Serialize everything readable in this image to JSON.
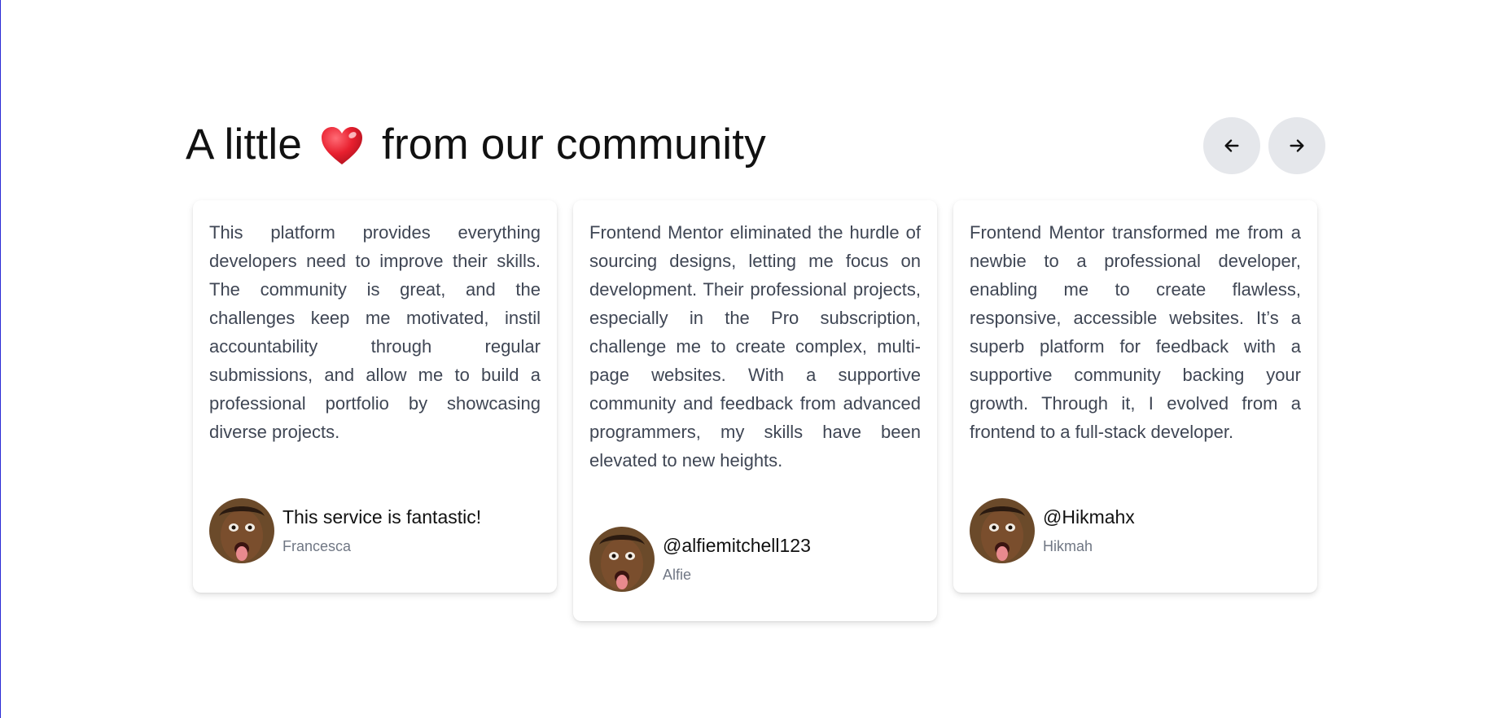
{
  "section": {
    "heading_before": "A little",
    "heading_after": "from our community",
    "heart_icon": "red-heart-emoji",
    "nav": {
      "prev_icon": "arrow-left-icon",
      "next_icon": "arrow-right-icon"
    }
  },
  "colors": {
    "text_primary": "#111111",
    "text_body": "#3f4654",
    "text_muted": "#707784",
    "nav_button_bg": "#e5e7eb",
    "heart": "#e8202f"
  },
  "testimonials": [
    {
      "text": "This platform provides everything developers need to improve their skills. The community is great, and the challenges keep me motivated, instil accountability through regular submissions, and allow me to build a professional portfolio by showcasing diverse projects.",
      "handle": "This service is fantastic!",
      "name": "Francesca"
    },
    {
      "text": "Frontend Mentor eliminated the hurdle of sourcing designs, letting me focus on development. Their professional projects, especially in the Pro subscription, challenge me to create complex, multi-page websites. With a supportive community and feedback from advanced programmers, my skills have been elevated to new heights.",
      "handle": "@alfiemitchell123",
      "name": "Alfie"
    },
    {
      "text": "Frontend Mentor transformed me from a newbie to a professional developer, enabling me to create flawless, responsive, accessible websites. It’s a superb platform for feedback with a supportive community backing your growth. Through it, I evolved from a frontend to a full-stack developer.",
      "handle": "@Hikmahx",
      "name": "Hikmah"
    }
  ]
}
